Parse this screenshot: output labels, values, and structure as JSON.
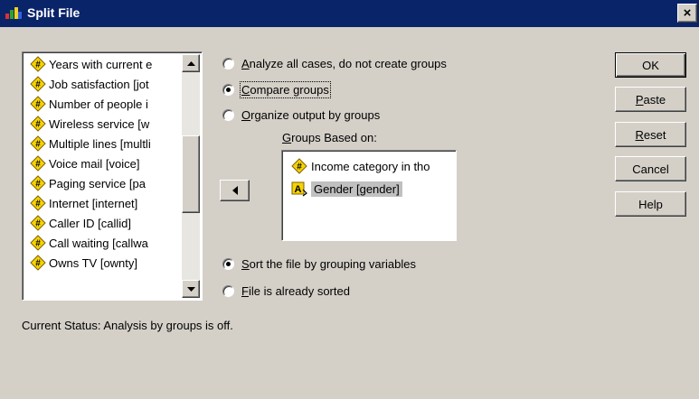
{
  "window": {
    "title": "Split File",
    "close_label": "×"
  },
  "variables": [
    {
      "label": "Years with current e",
      "icon": "scale-variable-icon"
    },
    {
      "label": "Job satisfaction [jot",
      "icon": "scale-variable-icon"
    },
    {
      "label": "Number of people i",
      "icon": "scale-variable-icon"
    },
    {
      "label": "Wireless service [w",
      "icon": "scale-variable-icon"
    },
    {
      "label": "Multiple lines [multli",
      "icon": "scale-variable-icon"
    },
    {
      "label": "Voice mail [voice]",
      "icon": "scale-variable-icon"
    },
    {
      "label": "Paging service [pa",
      "icon": "scale-variable-icon"
    },
    {
      "label": "Internet [internet]",
      "icon": "scale-variable-icon"
    },
    {
      "label": "Caller ID [callid]",
      "icon": "scale-variable-icon"
    },
    {
      "label": "Call waiting [callwa",
      "icon": "scale-variable-icon"
    },
    {
      "label": "Owns TV [ownty]",
      "icon": "scale-variable-icon"
    }
  ],
  "options": {
    "analyze_all": {
      "pre": "",
      "u": "A",
      "post": "nalyze all cases, do not create groups",
      "checked": false
    },
    "compare_groups": {
      "pre": "",
      "u": "C",
      "post": "ompare groups",
      "checked": true
    },
    "organize_output": {
      "pre": "",
      "u": "O",
      "post": "rganize output by groups",
      "checked": false
    }
  },
  "groups_based_on": {
    "label_u": "G",
    "label_rest": "roups Based on:",
    "items": [
      {
        "label": "Income category in tho",
        "icon": "scale-variable-icon"
      },
      {
        "label": "Gender [gender]",
        "icon": "string-variable-icon",
        "selected": true
      }
    ]
  },
  "sort_options": {
    "sort_by_grouping": {
      "pre": "",
      "u": "S",
      "post": "ort the file by grouping variables",
      "checked": true
    },
    "already_sorted": {
      "pre": "",
      "u": "F",
      "post": "ile is already sorted",
      "checked": false
    }
  },
  "buttons": {
    "ok": "OK",
    "paste_u": "P",
    "paste_rest": "aste",
    "reset_u": "R",
    "reset_rest": "eset",
    "cancel": "Cancel",
    "help": "Help"
  },
  "status": "Current Status:  Analysis by groups is off.",
  "colors": {
    "titlebar": "#0a246a",
    "dialog_bg": "#d4d0c8",
    "selection": "#c0c0c0"
  }
}
